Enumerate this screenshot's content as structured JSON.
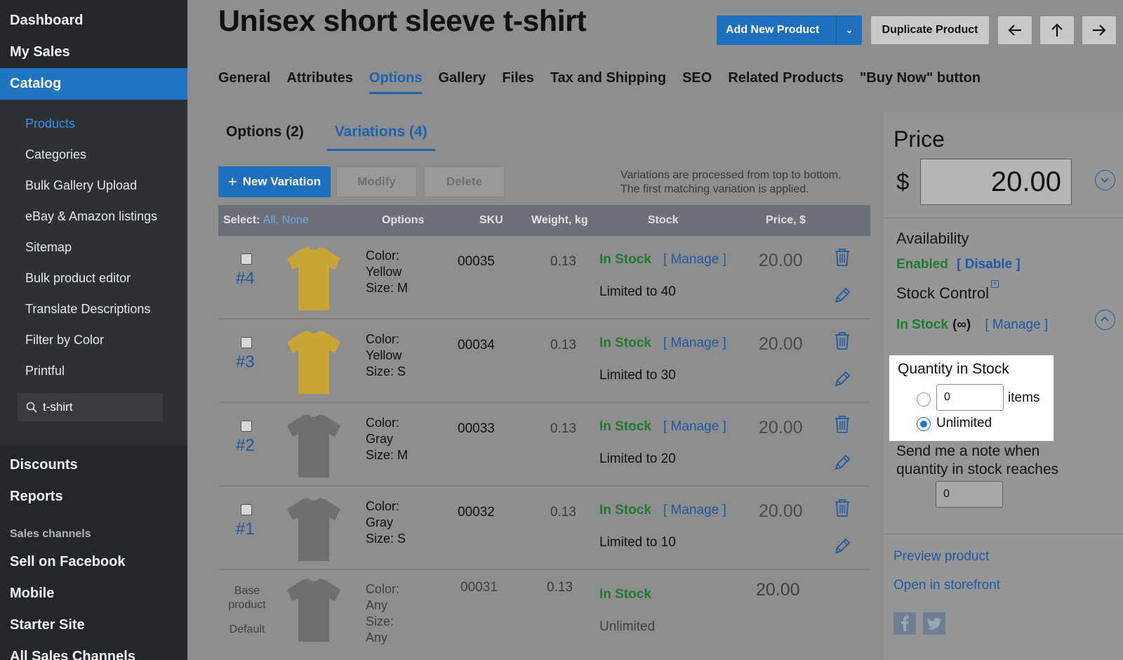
{
  "sidebar": {
    "top": [
      "Dashboard",
      "My Sales"
    ],
    "catalog": "Catalog",
    "sub": [
      "Products",
      "Categories",
      "Bulk Gallery Upload",
      "eBay & Amazon listings",
      "Sitemap",
      "Bulk product editor",
      "Translate Descriptions",
      "Filter by Color",
      "Printful"
    ],
    "search_value": "t-shirt",
    "bottom": [
      "Discounts",
      "Reports"
    ],
    "sales_channels_label": "Sales channels",
    "channels": [
      "Sell on Facebook",
      "Mobile",
      "Starter Site",
      "All Sales Channels"
    ]
  },
  "header": {
    "title": "Unisex short sleeve t-shirt",
    "add_new": "Add New Product",
    "duplicate": "Duplicate Product"
  },
  "tabs": [
    "General",
    "Attributes",
    "Options",
    "Gallery",
    "Files",
    "Tax and Shipping",
    "SEO",
    "Related Products",
    "\"Buy Now\" button"
  ],
  "subtabs": [
    "Options (2)",
    "Variations (4)"
  ],
  "toolbar": {
    "new_variation": "New Variation",
    "modify": "Modify",
    "delete": "Delete",
    "note_line1": "Variations are processed from top to bottom.",
    "note_line2": "The first matching variation is applied."
  },
  "table": {
    "select_label": "Select:",
    "select_all": "All",
    "select_none": "None",
    "headers": {
      "options": "Options",
      "sku": "SKU",
      "weight": "Weight, kg",
      "stock": "Stock",
      "price": "Price, $"
    },
    "rows": [
      {
        "num": "#4",
        "opt1": "Color:",
        "opt2": "Yellow",
        "opt3": "Size: M",
        "sku": "00035",
        "weight": "0.13",
        "stock": "In Stock",
        "manage": "[ Manage ]",
        "limited": "Limited to 40",
        "price": "20.00",
        "shirt_color": "#c9a535"
      },
      {
        "num": "#3",
        "opt1": "Color:",
        "opt2": "Yellow",
        "opt3": "Size: S",
        "sku": "00034",
        "weight": "0.13",
        "stock": "In Stock",
        "manage": "[ Manage ]",
        "limited": "Limited to 30",
        "price": "20.00",
        "shirt_color": "#c9a535"
      },
      {
        "num": "#2",
        "opt1": "Color:",
        "opt2": "Gray",
        "opt3": "Size: M",
        "sku": "00033",
        "weight": "0.13",
        "stock": "In Stock",
        "manage": "[ Manage ]",
        "limited": "Limited to 20",
        "price": "20.00",
        "shirt_color": "#6f6f6f"
      },
      {
        "num": "#1",
        "opt1": "Color:",
        "opt2": "Gray",
        "opt3": "Size: S",
        "sku": "00032",
        "weight": "0.13",
        "stock": "In Stock",
        "manage": "[ Manage ]",
        "limited": "Limited to 10",
        "price": "20.00",
        "shirt_color": "#6f6f6f"
      }
    ],
    "base": {
      "label1": "Base",
      "label2": "product",
      "label3": "Default",
      "opt1": "Color:",
      "opt2": "Any",
      "opt3": "Size:",
      "opt4": "Any",
      "sku": "00031",
      "weight": "0.13",
      "stock": "In Stock",
      "limited": "Unlimited",
      "price": "20.00"
    }
  },
  "panel": {
    "price_title": "Price",
    "currency": "$",
    "price_value": "20.00",
    "availability_label": "Availability",
    "enabled": "Enabled",
    "disable": "[ Disable ]",
    "stock_control": "Stock Control",
    "in_stock": "In Stock",
    "infinity": "(∞)",
    "manage": "[ Manage ]",
    "qty_title": "Quantity in Stock",
    "qty_value": "0",
    "items": "items",
    "unlimited": "Unlimited",
    "note_line1": "Send me a note when",
    "note_line2": "quantity in stock reaches",
    "note_value": "0",
    "preview": "Preview product",
    "storefront": "Open in storefront"
  }
}
